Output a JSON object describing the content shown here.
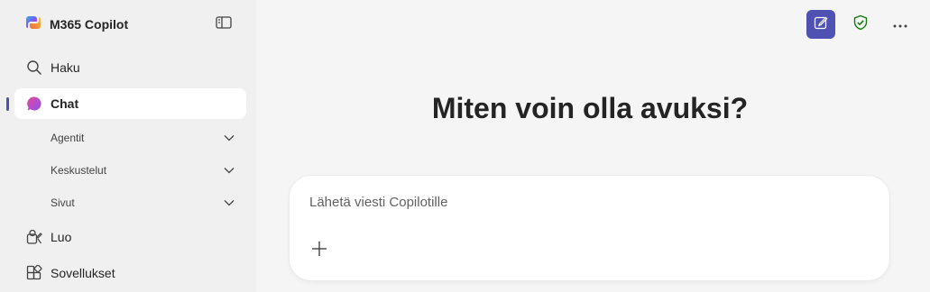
{
  "brand": {
    "title": "M365 Copilot",
    "icon": "copilot-logo-icon"
  },
  "nav": {
    "search": {
      "label": "Haku",
      "icon": "search-icon"
    },
    "chat": {
      "label": "Chat",
      "icon": "chat-icon"
    },
    "agents": {
      "label": "Agentit",
      "icon": "chevron-down-icon"
    },
    "conversations": {
      "label": "Keskustelut",
      "icon": "chevron-down-icon"
    },
    "pages": {
      "label": "Sivut",
      "icon": "chevron-down-icon"
    },
    "create": {
      "label": "Luo",
      "icon": "create-icon"
    },
    "apps": {
      "label": "Sovellukset",
      "icon": "apps-icon"
    }
  },
  "main": {
    "headline": "Miten voin olla avuksi?",
    "composer_placeholder": "Lähetä viesti Copilotille"
  },
  "colors": {
    "accent": "#4f52b2",
    "shield": "#107c10",
    "sidebar_bg": "#f0f0f0",
    "main_bg": "#f5f5f5"
  }
}
